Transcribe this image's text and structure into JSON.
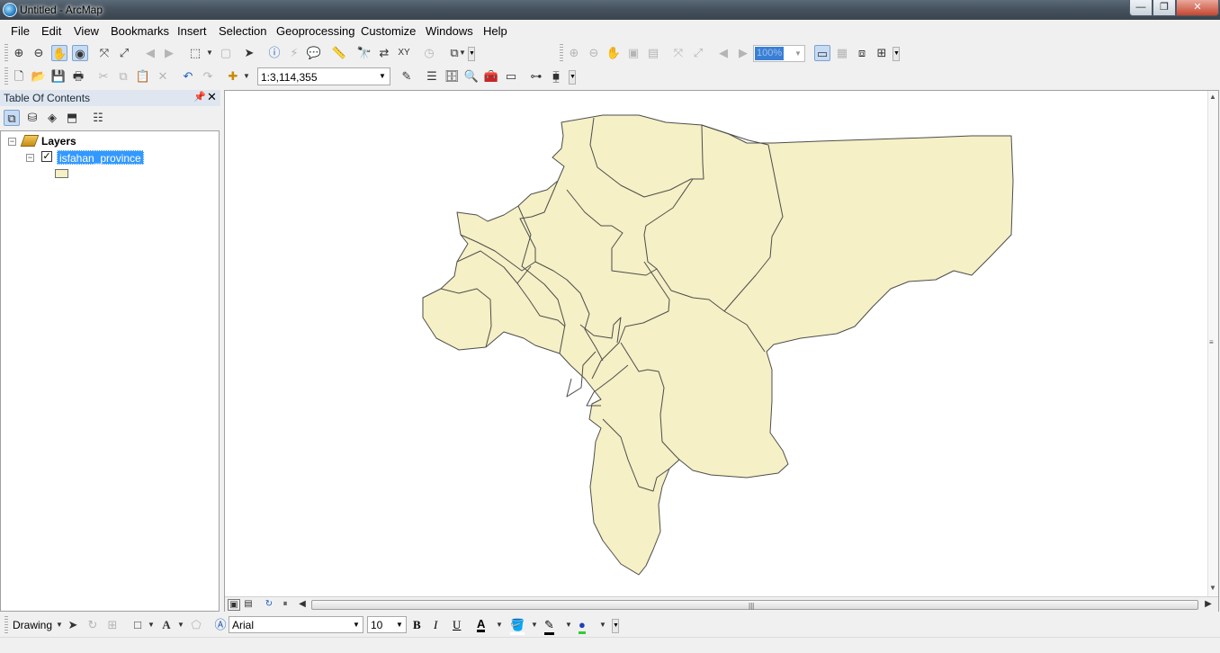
{
  "window": {
    "title": "Untitled - ArcMap",
    "minimize": "—",
    "maximize": "❐",
    "close": "✕"
  },
  "menu": [
    "File",
    "Edit",
    "View",
    "Bookmarks",
    "Insert",
    "Selection",
    "Geoprocessing",
    "Customize",
    "Windows",
    "Help"
  ],
  "standard_toolbar": {
    "map_scale": "1:3,114,355"
  },
  "layout_toolbar": {
    "zoom_percent": "100%"
  },
  "toc": {
    "title": "Table Of Contents",
    "root_label": "Layers",
    "layers": [
      {
        "name": "isfahan_province",
        "visible": true,
        "fill_color": "#f5f0c5"
      }
    ]
  },
  "map": {
    "fill_color": "#f5f0c5",
    "outline_color": "#4d4d4d"
  },
  "drawing_toolbar": {
    "menu_label": "Drawing",
    "font": "Arial",
    "font_size": "10",
    "bold": "B",
    "italic": "I",
    "underline": "U",
    "font_color_glyph": "A"
  }
}
